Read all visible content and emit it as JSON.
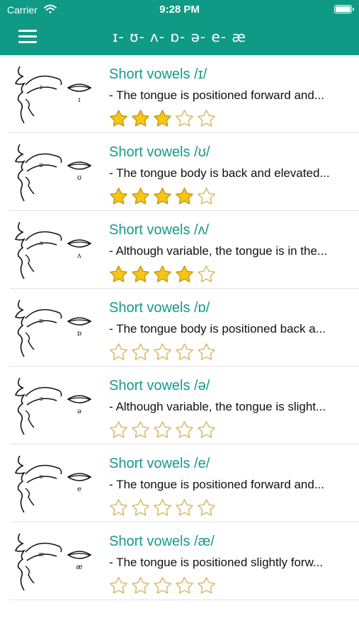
{
  "status_bar": {
    "carrier": "Carrier",
    "time": "9:28 PM"
  },
  "nav": {
    "title": "ɪ- ʊ- ʌ- ɒ- ə- e- æ",
    "menu_icon": "hamburger-menu-icon"
  },
  "colors": {
    "accent": "#0f9a86",
    "title_text": "#15998a",
    "star_fill": "#f5c518",
    "star_outline": "#d9b860"
  },
  "rating_max": 5,
  "items": [
    {
      "title": "Short vowels /ɪ/",
      "description": "- The tongue is positioned forward and...",
      "rating": 3,
      "symbol": "ɪ",
      "icon": "mouth-diagram-icon"
    },
    {
      "title": "Short vowels /ʊ/",
      "description": "- The tongue body is back and elevated...",
      "rating": 4,
      "symbol": "ʊ",
      "icon": "mouth-diagram-icon"
    },
    {
      "title": "Short vowels /ʌ/",
      "description": "- Although variable, the tongue is in the...",
      "rating": 4,
      "symbol": "ʌ",
      "icon": "mouth-diagram-icon"
    },
    {
      "title": "Short vowels /ɒ/",
      "description": "- The tongue body is positioned back a...",
      "rating": 0,
      "symbol": "ɒ",
      "icon": "mouth-diagram-icon"
    },
    {
      "title": "Short vowels /ə/",
      "description": "- Although variable, the tongue is slight...",
      "rating": 0,
      "symbol": "ə",
      "icon": "mouth-diagram-icon"
    },
    {
      "title": "Short vowels /e/",
      "description": "- The tongue is positioned forward and...",
      "rating": 0,
      "symbol": "e",
      "icon": "mouth-diagram-icon"
    },
    {
      "title": "Short vowels /æ/",
      "description": "- The tongue is positioned slightly forw...",
      "rating": 0,
      "symbol": "æ",
      "icon": "mouth-diagram-icon"
    }
  ]
}
